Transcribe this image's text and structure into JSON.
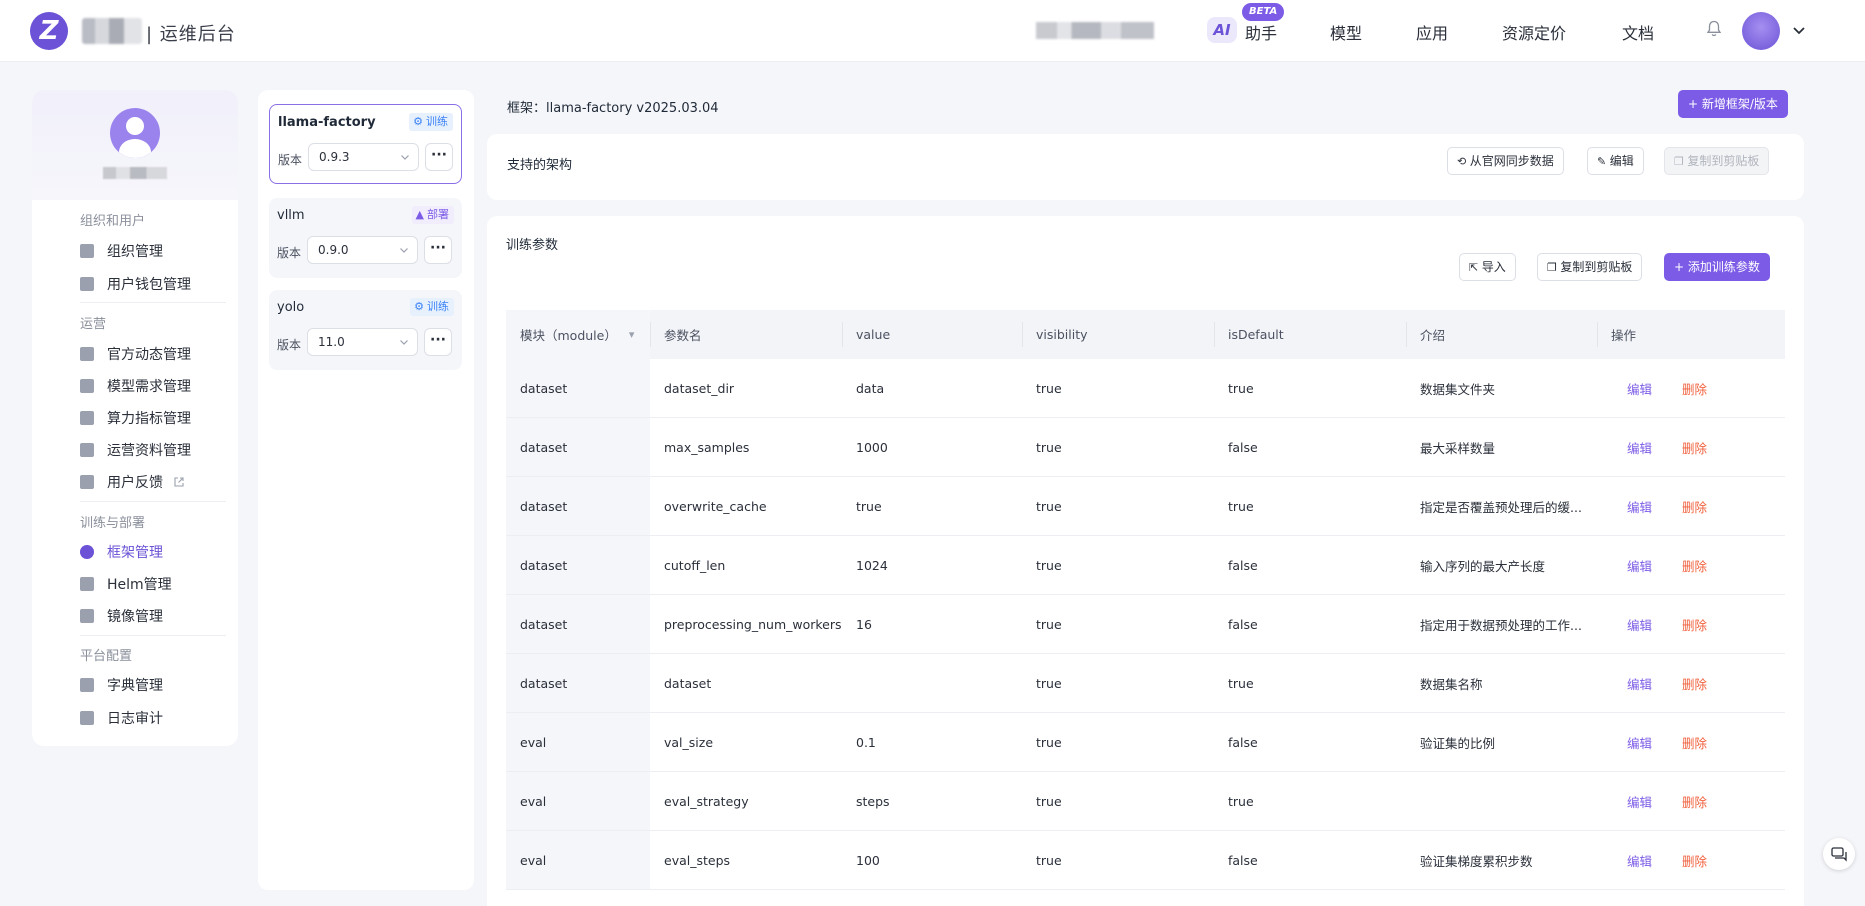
{
  "header": {
    "app_title": "| 运维后台",
    "ai_label": "AI",
    "beta": "BETA",
    "nav": [
      "助手",
      "模型",
      "应用",
      "资源定价",
      "文档"
    ]
  },
  "sidebar": {
    "groups": [
      {
        "title": "组织和用户",
        "items": [
          {
            "label": "组织管理",
            "icon": "org-icon"
          },
          {
            "label": "用户钱包管理",
            "icon": "wallet-icon"
          }
        ]
      },
      {
        "title": "运营",
        "items": [
          {
            "label": "官方动态管理",
            "icon": "news-icon"
          },
          {
            "label": "模型需求管理",
            "icon": "users-icon"
          },
          {
            "label": "算力指标管理",
            "icon": "compute-icon"
          },
          {
            "label": "运营资料管理",
            "icon": "book-icon"
          },
          {
            "label": "用户反馈",
            "icon": "feedback-icon"
          }
        ]
      },
      {
        "title": "训练与部署",
        "items": [
          {
            "label": "框架管理",
            "icon": "framework-icon"
          },
          {
            "label": "Helm管理",
            "icon": "helm-icon"
          },
          {
            "label": "镜像管理",
            "icon": "image-icon"
          }
        ]
      },
      {
        "title": "平台配置",
        "items": [
          {
            "label": "字典管理",
            "icon": "dictionary-icon"
          },
          {
            "label": "日志审计",
            "icon": "log-icon"
          }
        ]
      }
    ],
    "active": "框架管理"
  },
  "frameworks": [
    {
      "name": "llama-factory",
      "tag": "训练",
      "tag_type": "train",
      "version_label": "版本",
      "version": "0.9.3",
      "more": "···"
    },
    {
      "name": "vllm",
      "tag": "部署",
      "tag_type": "deploy",
      "version_label": "版本",
      "version": "0.9.0",
      "more": "···"
    },
    {
      "name": "yolo",
      "tag": "训练",
      "tag_type": "train",
      "version_label": "版本",
      "version": "11.0",
      "more": "···"
    }
  ],
  "main": {
    "title": "框架：llama-factory v2025.03.04",
    "add_framework_button": "+ 新增框架/版本",
    "arch": {
      "title": "支持的架构",
      "sync_button": "从官网同步数据",
      "edit_button": "编辑",
      "copy_button": "复制到剪贴板"
    },
    "params": {
      "title": "训练参数",
      "import_button": "导入",
      "copy_button": "复制到剪贴板",
      "add_button": "+ 添加训练参数"
    }
  },
  "table": {
    "headers": [
      "模块（module）",
      "参数名",
      "value",
      "visibility",
      "isDefault",
      "介绍",
      "操作"
    ],
    "edit_label": "编辑",
    "delete_label": "删除",
    "rows": [
      [
        "dataset",
        "dataset_dir",
        "data",
        "true",
        "true",
        "数据集文件夹"
      ],
      [
        "dataset",
        "max_samples",
        "1000",
        "true",
        "false",
        "最大采样数量"
      ],
      [
        "dataset",
        "overwrite_cache",
        "true",
        "true",
        "true",
        "指定是否覆盖预处理后的缓..."
      ],
      [
        "dataset",
        "cutoff_len",
        "1024",
        "true",
        "false",
        "输入序列的最大产长度"
      ],
      [
        "dataset",
        "preprocessing_num_workers",
        "16",
        "true",
        "false",
        "指定用于数据预处理的工作..."
      ],
      [
        "dataset",
        "dataset",
        "",
        "true",
        "true",
        "数据集名称"
      ],
      [
        "eval",
        "val_size",
        "0.1",
        "true",
        "false",
        "验证集的比例"
      ],
      [
        "eval",
        "eval_strategy",
        "steps",
        "true",
        "true",
        ""
      ],
      [
        "eval",
        "eval_steps",
        "100",
        "true",
        "false",
        "验证集梯度累积步数"
      ]
    ]
  },
  "colors": {
    "accent": "#7c5ce6",
    "danger": "#f0603c",
    "train_tag": "#3b82f6"
  }
}
